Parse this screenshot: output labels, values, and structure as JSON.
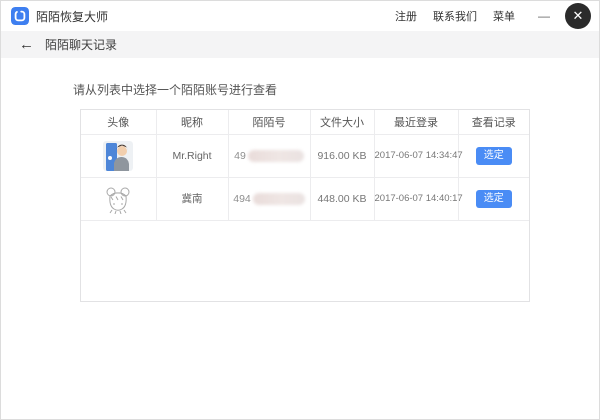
{
  "titlebar": {
    "app_title": "陌陌恢复大师",
    "links": [
      {
        "label": "注册"
      },
      {
        "label": "联系我们"
      },
      {
        "label": "菜单"
      }
    ],
    "minimize_glyph": "—",
    "close_glyph": "✕"
  },
  "subheader": {
    "back_glyph": "←",
    "title": "陌陌聊天记录"
  },
  "main": {
    "instruction": "请从列表中选择一个陌陌账号进行查看"
  },
  "table": {
    "headers": [
      "头像",
      "昵称",
      "陌陌号",
      "文件大小",
      "最近登录",
      "查看记录"
    ],
    "rows": [
      {
        "avatar": "man-cartoon-avatar",
        "nickname": "Mr.Right",
        "momo_id_visible": "49",
        "momo_id_redacted": true,
        "file_size": "916.00 KB",
        "last_login": "2017-06-07 14:34:47",
        "action_label": "选定"
      },
      {
        "avatar": "anime-girl-sketch-avatar",
        "nickname": "冀南",
        "momo_id_visible": "494",
        "momo_id_redacted": true,
        "file_size": "448.00 KB",
        "last_login": "2017-06-07 14:40:17",
        "action_label": "选定"
      }
    ]
  },
  "colors": {
    "accent_blue": "#4a8cf5",
    "brand_icon_blue": "#3e7ff0",
    "close_button_bg": "#2b2b2b",
    "subheader_bg": "#f4f4f5",
    "table_border": "#ececee"
  }
}
